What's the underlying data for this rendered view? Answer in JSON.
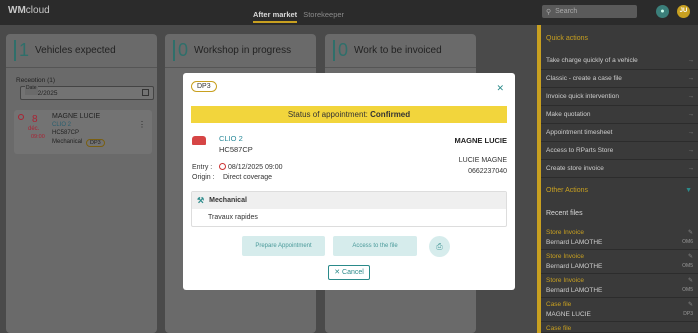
{
  "app": {
    "logo_wm": "WM",
    "logo_cloud": "cloud"
  },
  "nav": {
    "tabs": [
      {
        "label": "After market",
        "active": true
      },
      {
        "label": "Storekeeper",
        "active": false
      }
    ]
  },
  "header": {
    "search_placeholder": "Search",
    "avatar_initials": "JU"
  },
  "columns": [
    {
      "count": "1",
      "title": "Vehicles expected"
    },
    {
      "count": "0",
      "title": "Workshop in progress"
    },
    {
      "count": "0",
      "title": "Work to be invoiced"
    }
  ],
  "reception": {
    "label": "Reception (1)",
    "date_label": "Date",
    "date_value": "08/12/2025",
    "card": {
      "day": "8",
      "month": "déc.",
      "time": "09:00",
      "customer": "MAGNE LUCIE",
      "vehicle": "CLIO 2",
      "plate": "HC587CP",
      "work_type": "Mechanical",
      "tag": "DP3"
    }
  },
  "sidebar": {
    "quick_actions_title": "Quick actions",
    "quick_actions": [
      "Take charge quickly of a vehicle",
      "Classic - create a case file",
      "Invoice quick intervention",
      "Make quotation",
      "Appointment timesheet",
      "Access to RParts Store",
      "Create store invoice"
    ],
    "other_actions_title": "Other Actions",
    "recent_files_title": "Recent files",
    "recent_files": [
      {
        "type": "Store Invoice",
        "name": "Bernard LAMOTHE",
        "code": "OM6"
      },
      {
        "type": "Store Invoice",
        "name": "Bernard LAMOTHE",
        "code": "OM5"
      },
      {
        "type": "Store Invoice",
        "name": "Bernard LAMOTHE",
        "code": "OM5"
      },
      {
        "type": "Case file",
        "name": "MAGNE LUCIE",
        "code": "DP3"
      },
      {
        "type": "Case file",
        "name": "",
        "code": ""
      }
    ]
  },
  "modal": {
    "badge": "DP3",
    "status_label": "Status of appointment:",
    "status_value": "Confirmed",
    "vehicle_name": "CLIO 2",
    "vehicle_plate": "HC587CP",
    "customer_name": "MAGNE LUCIE",
    "entry_label": "Entry :",
    "entry_value": "08/12/2025 09:00",
    "origin_label": "Origin :",
    "origin_value": "Direct coverage",
    "contact_name": "LUCIE MAGNE",
    "contact_phone": "0662237040",
    "section_title": "Mechanical",
    "section_item": "Travaux rapides",
    "btn_prepare": "Prepare Appointment",
    "btn_access": "Access to the file",
    "btn_cancel": "Cancel"
  }
}
